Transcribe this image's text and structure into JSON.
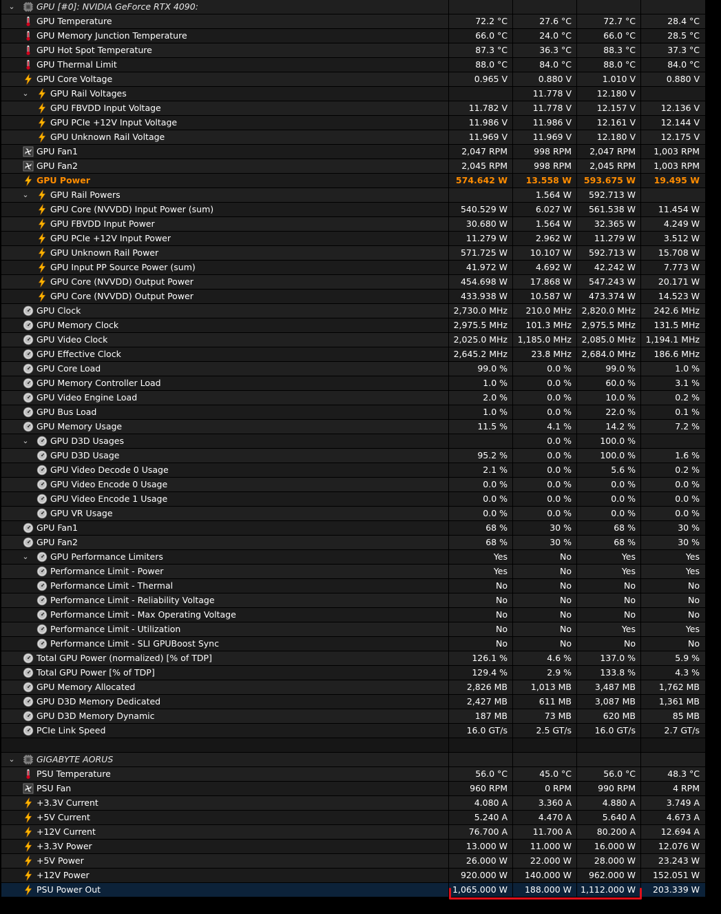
{
  "colors": {
    "orange": "#ff8c00",
    "selection": "#0c2239",
    "underline": "#e0101a"
  },
  "rows": [
    {
      "indent": 0,
      "expander": true,
      "icon": "chip-icon",
      "label": "GPU [#0]: NVIDIA GeForce RTX 4090:",
      "values": [
        "",
        "",
        "",
        ""
      ],
      "kind": "group"
    },
    {
      "indent": 0,
      "icon": "thermometer-icon",
      "label": "GPU Temperature",
      "values": [
        "72.2 °C",
        "27.6 °C",
        "72.7 °C",
        "28.4 °C"
      ]
    },
    {
      "indent": 0,
      "icon": "thermometer-icon",
      "label": "GPU Memory Junction Temperature",
      "values": [
        "66.0 °C",
        "24.0 °C",
        "66.0 °C",
        "28.5 °C"
      ]
    },
    {
      "indent": 0,
      "icon": "thermometer-icon",
      "label": "GPU Hot Spot Temperature",
      "values": [
        "87.3 °C",
        "36.3 °C",
        "88.3 °C",
        "37.3 °C"
      ]
    },
    {
      "indent": 0,
      "icon": "thermometer-icon",
      "label": "GPU Thermal Limit",
      "values": [
        "88.0 °C",
        "84.0 °C",
        "88.0 °C",
        "84.0 °C"
      ]
    },
    {
      "indent": 0,
      "icon": "bolt-icon",
      "label": "GPU Core Voltage",
      "values": [
        "0.965 V",
        "0.880 V",
        "1.010 V",
        "0.880 V"
      ]
    },
    {
      "indent": 1,
      "expander": true,
      "icon": "bolt-icon",
      "label": "GPU Rail Voltages",
      "values": [
        "",
        "11.778 V",
        "12.180 V",
        ""
      ]
    },
    {
      "indent": 1,
      "icon": "bolt-icon",
      "label": "GPU FBVDD Input Voltage",
      "values": [
        "11.782 V",
        "11.778 V",
        "12.157 V",
        "12.136 V"
      ]
    },
    {
      "indent": 1,
      "icon": "bolt-icon",
      "label": "GPU PCIe +12V Input Voltage",
      "values": [
        "11.986 V",
        "11.986 V",
        "12.161 V",
        "12.144 V"
      ]
    },
    {
      "indent": 1,
      "icon": "bolt-icon",
      "label": "GPU Unknown Rail Voltage",
      "values": [
        "11.969 V",
        "11.969 V",
        "12.180 V",
        "12.175 V"
      ]
    },
    {
      "indent": 0,
      "icon": "fan-icon",
      "label": "GPU Fan1",
      "values": [
        "2,047 RPM",
        "998 RPM",
        "2,047 RPM",
        "1,003 RPM"
      ]
    },
    {
      "indent": 0,
      "icon": "fan-icon",
      "label": "GPU Fan2",
      "values": [
        "2,045 RPM",
        "998 RPM",
        "2,045 RPM",
        "1,003 RPM"
      ]
    },
    {
      "indent": 0,
      "icon": "bolt-icon",
      "label": "GPU Power",
      "values": [
        "574.642 W",
        "13.558 W",
        "593.675 W",
        "19.495 W"
      ],
      "kind": "orange"
    },
    {
      "indent": 1,
      "expander": true,
      "icon": "bolt-icon",
      "label": "GPU Rail Powers",
      "values": [
        "",
        "1.564 W",
        "592.713 W",
        ""
      ]
    },
    {
      "indent": 1,
      "icon": "bolt-icon",
      "label": "GPU Core (NVVDD) Input Power (sum)",
      "values": [
        "540.529 W",
        "6.027 W",
        "561.538 W",
        "11.454 W"
      ]
    },
    {
      "indent": 1,
      "icon": "bolt-icon",
      "label": "GPU FBVDD Input Power",
      "values": [
        "30.680 W",
        "1.564 W",
        "32.365 W",
        "4.249 W"
      ]
    },
    {
      "indent": 1,
      "icon": "bolt-icon",
      "label": "GPU PCIe +12V Input Power",
      "values": [
        "11.279 W",
        "2.962 W",
        "11.279 W",
        "3.512 W"
      ]
    },
    {
      "indent": 1,
      "icon": "bolt-icon",
      "label": "GPU Unknown Rail Power",
      "values": [
        "571.725 W",
        "10.107 W",
        "592.713 W",
        "15.708 W"
      ]
    },
    {
      "indent": 1,
      "icon": "bolt-icon",
      "label": "GPU Input PP Source Power (sum)",
      "values": [
        "41.972 W",
        "4.692 W",
        "42.242 W",
        "7.773 W"
      ]
    },
    {
      "indent": 1,
      "icon": "bolt-icon",
      "label": "GPU Core (NVVDD) Output Power",
      "values": [
        "454.698 W",
        "17.868 W",
        "547.243 W",
        "20.171 W"
      ]
    },
    {
      "indent": 1,
      "icon": "bolt-icon",
      "label": "GPU Core (NVVDD) Output Power",
      "values": [
        "433.938 W",
        "10.587 W",
        "473.374 W",
        "14.523 W"
      ]
    },
    {
      "indent": 0,
      "icon": "gauge-icon",
      "label": "GPU Clock",
      "values": [
        "2,730.0 MHz",
        "210.0 MHz",
        "2,820.0 MHz",
        "242.6 MHz"
      ]
    },
    {
      "indent": 0,
      "icon": "gauge-icon",
      "label": "GPU Memory Clock",
      "values": [
        "2,975.5 MHz",
        "101.3 MHz",
        "2,975.5 MHz",
        "131.5 MHz"
      ]
    },
    {
      "indent": 0,
      "icon": "gauge-icon",
      "label": "GPU Video Clock",
      "values": [
        "2,025.0 MHz",
        "1,185.0 MHz",
        "2,085.0 MHz",
        "1,194.1 MHz"
      ]
    },
    {
      "indent": 0,
      "icon": "gauge-icon",
      "label": "GPU Effective Clock",
      "values": [
        "2,645.2 MHz",
        "23.8 MHz",
        "2,684.0 MHz",
        "186.6 MHz"
      ]
    },
    {
      "indent": 0,
      "icon": "gauge-icon",
      "label": "GPU Core Load",
      "values": [
        "99.0 %",
        "0.0 %",
        "99.0 %",
        "1.0 %"
      ]
    },
    {
      "indent": 0,
      "icon": "gauge-icon",
      "label": "GPU Memory Controller Load",
      "values": [
        "1.0 %",
        "0.0 %",
        "60.0 %",
        "3.1 %"
      ]
    },
    {
      "indent": 0,
      "icon": "gauge-icon",
      "label": "GPU Video Engine Load",
      "values": [
        "2.0 %",
        "0.0 %",
        "10.0 %",
        "0.2 %"
      ]
    },
    {
      "indent": 0,
      "icon": "gauge-icon",
      "label": "GPU Bus Load",
      "values": [
        "1.0 %",
        "0.0 %",
        "22.0 %",
        "0.1 %"
      ]
    },
    {
      "indent": 0,
      "icon": "gauge-icon",
      "label": "GPU Memory Usage",
      "values": [
        "11.5 %",
        "4.1 %",
        "14.2 %",
        "7.2 %"
      ]
    },
    {
      "indent": 1,
      "expander": true,
      "icon": "gauge-icon",
      "label": "GPU D3D Usages",
      "values": [
        "",
        "0.0 %",
        "100.0 %",
        ""
      ]
    },
    {
      "indent": 1,
      "icon": "gauge-icon",
      "label": "GPU D3D Usage",
      "values": [
        "95.2 %",
        "0.0 %",
        "100.0 %",
        "1.6 %"
      ]
    },
    {
      "indent": 1,
      "icon": "gauge-icon",
      "label": "GPU Video Decode 0 Usage",
      "values": [
        "2.1 %",
        "0.0 %",
        "5.6 %",
        "0.2 %"
      ]
    },
    {
      "indent": 1,
      "icon": "gauge-icon",
      "label": "GPU Video Encode 0 Usage",
      "values": [
        "0.0 %",
        "0.0 %",
        "0.0 %",
        "0.0 %"
      ]
    },
    {
      "indent": 1,
      "icon": "gauge-icon",
      "label": "GPU Video Encode 1 Usage",
      "values": [
        "0.0 %",
        "0.0 %",
        "0.0 %",
        "0.0 %"
      ]
    },
    {
      "indent": 1,
      "icon": "gauge-icon",
      "label": "GPU VR Usage",
      "values": [
        "0.0 %",
        "0.0 %",
        "0.0 %",
        "0.0 %"
      ]
    },
    {
      "indent": 0,
      "icon": "gauge-icon",
      "label": "GPU Fan1",
      "values": [
        "68 %",
        "30 %",
        "68 %",
        "30 %"
      ]
    },
    {
      "indent": 0,
      "icon": "gauge-icon",
      "label": "GPU Fan2",
      "values": [
        "68 %",
        "30 %",
        "68 %",
        "30 %"
      ]
    },
    {
      "indent": 1,
      "expander": true,
      "icon": "gauge-icon",
      "label": "GPU Performance Limiters",
      "values": [
        "Yes",
        "No",
        "Yes",
        "Yes"
      ]
    },
    {
      "indent": 1,
      "icon": "gauge-icon",
      "label": "Performance Limit - Power",
      "values": [
        "Yes",
        "No",
        "Yes",
        "Yes"
      ]
    },
    {
      "indent": 1,
      "icon": "gauge-icon",
      "label": "Performance Limit - Thermal",
      "values": [
        "No",
        "No",
        "No",
        "No"
      ]
    },
    {
      "indent": 1,
      "icon": "gauge-icon",
      "label": "Performance Limit - Reliability Voltage",
      "values": [
        "No",
        "No",
        "No",
        "No"
      ]
    },
    {
      "indent": 1,
      "icon": "gauge-icon",
      "label": "Performance Limit - Max Operating Voltage",
      "values": [
        "No",
        "No",
        "No",
        "No"
      ]
    },
    {
      "indent": 1,
      "icon": "gauge-icon",
      "label": "Performance Limit - Utilization",
      "values": [
        "No",
        "No",
        "Yes",
        "Yes"
      ]
    },
    {
      "indent": 1,
      "icon": "gauge-icon",
      "label": "Performance Limit - SLI GPUBoost Sync",
      "values": [
        "No",
        "No",
        "No",
        "No"
      ]
    },
    {
      "indent": 0,
      "icon": "gauge-icon",
      "label": "Total GPU Power (normalized) [% of TDP]",
      "values": [
        "126.1 %",
        "4.6 %",
        "137.0 %",
        "5.9 %"
      ]
    },
    {
      "indent": 0,
      "icon": "gauge-icon",
      "label": "Total GPU Power [% of TDP]",
      "values": [
        "129.4 %",
        "2.9 %",
        "133.8 %",
        "4.3 %"
      ]
    },
    {
      "indent": 0,
      "icon": "gauge-icon",
      "label": "GPU Memory Allocated",
      "values": [
        "2,826 MB",
        "1,013 MB",
        "3,487 MB",
        "1,762 MB"
      ]
    },
    {
      "indent": 0,
      "icon": "gauge-icon",
      "label": "GPU D3D Memory Dedicated",
      "values": [
        "2,427 MB",
        "611 MB",
        "3,087 MB",
        "1,361 MB"
      ]
    },
    {
      "indent": 0,
      "icon": "gauge-icon",
      "label": "GPU D3D Memory Dynamic",
      "values": [
        "187 MB",
        "73 MB",
        "620 MB",
        "85 MB"
      ]
    },
    {
      "indent": 0,
      "icon": "gauge-icon",
      "label": "PCIe Link Speed",
      "values": [
        "16.0 GT/s",
        "2.5 GT/s",
        "16.0 GT/s",
        "2.7 GT/s"
      ]
    },
    {
      "indent": 0,
      "icon": "",
      "label": "",
      "values": [
        "",
        "",
        "",
        ""
      ],
      "kind": "blank"
    },
    {
      "indent": 0,
      "expander": true,
      "icon": "chip-icon",
      "label": "GIGABYTE AORUS",
      "values": [
        "",
        "",
        "",
        ""
      ],
      "kind": "group"
    },
    {
      "indent": 0,
      "icon": "thermometer-icon",
      "label": "PSU Temperature",
      "values": [
        "56.0 °C",
        "45.0 °C",
        "56.0 °C",
        "48.3 °C"
      ]
    },
    {
      "indent": 0,
      "icon": "fan-icon",
      "label": "PSU Fan",
      "values": [
        "960 RPM",
        "0 RPM",
        "990 RPM",
        "4 RPM"
      ]
    },
    {
      "indent": 0,
      "icon": "bolt-icon",
      "label": "+3.3V Current",
      "values": [
        "4.080 A",
        "3.360 A",
        "4.880 A",
        "3.749 A"
      ]
    },
    {
      "indent": 0,
      "icon": "bolt-icon",
      "label": "+5V Current",
      "values": [
        "5.240 A",
        "4.470 A",
        "5.640 A",
        "4.673 A"
      ]
    },
    {
      "indent": 0,
      "icon": "bolt-icon",
      "label": "+12V Current",
      "values": [
        "76.700 A",
        "11.700 A",
        "80.200 A",
        "12.694 A"
      ]
    },
    {
      "indent": 0,
      "icon": "bolt-icon",
      "label": "+3.3V Power",
      "values": [
        "13.000 W",
        "11.000 W",
        "16.000 W",
        "12.076 W"
      ]
    },
    {
      "indent": 0,
      "icon": "bolt-icon",
      "label": "+5V Power",
      "values": [
        "26.000 W",
        "22.000 W",
        "28.000 W",
        "23.243 W"
      ]
    },
    {
      "indent": 0,
      "icon": "bolt-icon",
      "label": "+12V Power",
      "values": [
        "920.000 W",
        "140.000 W",
        "962.000 W",
        "152.051 W"
      ]
    },
    {
      "indent": 0,
      "icon": "bolt-icon",
      "label": "PSU Power Out",
      "values": [
        "1,065.000 W",
        "188.000 W",
        "1,112.000 W",
        "203.339 W"
      ],
      "kind": "sel"
    }
  ]
}
